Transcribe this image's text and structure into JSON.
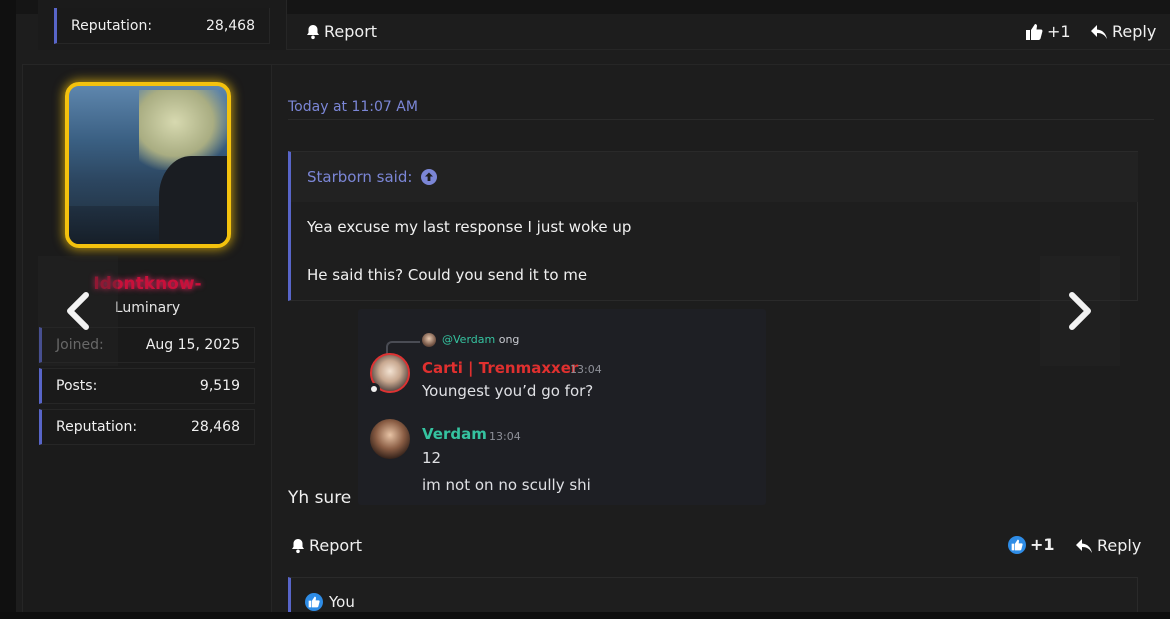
{
  "prev_post": {
    "reputation_label": "Reputation:",
    "reputation_value": "28,468",
    "report_label": "Report",
    "like_count": "+1",
    "reply_label": "Reply"
  },
  "post": {
    "username": "Idontknow-",
    "user_title": "Luminary",
    "stats": [
      {
        "label": "Joined:",
        "value": "Aug 15, 2025"
      },
      {
        "label": "Posts:",
        "value": "9,519"
      },
      {
        "label": "Reputation:",
        "value": "28,468"
      }
    ],
    "timestamp": "Today at 11:07 AM",
    "quote": {
      "author": "Starborn said:",
      "lines": [
        "Yea excuse my last response I just woke up",
        "He said this? Could you send it to me"
      ]
    },
    "discord": {
      "reply_mention": "@Verdam",
      "reply_text": "ong",
      "messages": [
        {
          "name": "Carti | Trenmaxxer",
          "time": "13:04",
          "text": "Youngest you’d go for?",
          "name_color": "#e0302f"
        },
        {
          "name": "Verdam",
          "time": "13:04",
          "text": "12",
          "text2": "im not on no scully shi",
          "name_color": "#35c3a0"
        }
      ]
    },
    "body_text": "Yh sure",
    "report_label": "Report",
    "like_count": "+1",
    "reply_label": "Reply",
    "likes_by": "You"
  },
  "colors": {
    "accent": "#5865c8",
    "link": "#7b86d6",
    "avatar_border": "#f4c20d",
    "like_blue": "#2e8ce6"
  }
}
